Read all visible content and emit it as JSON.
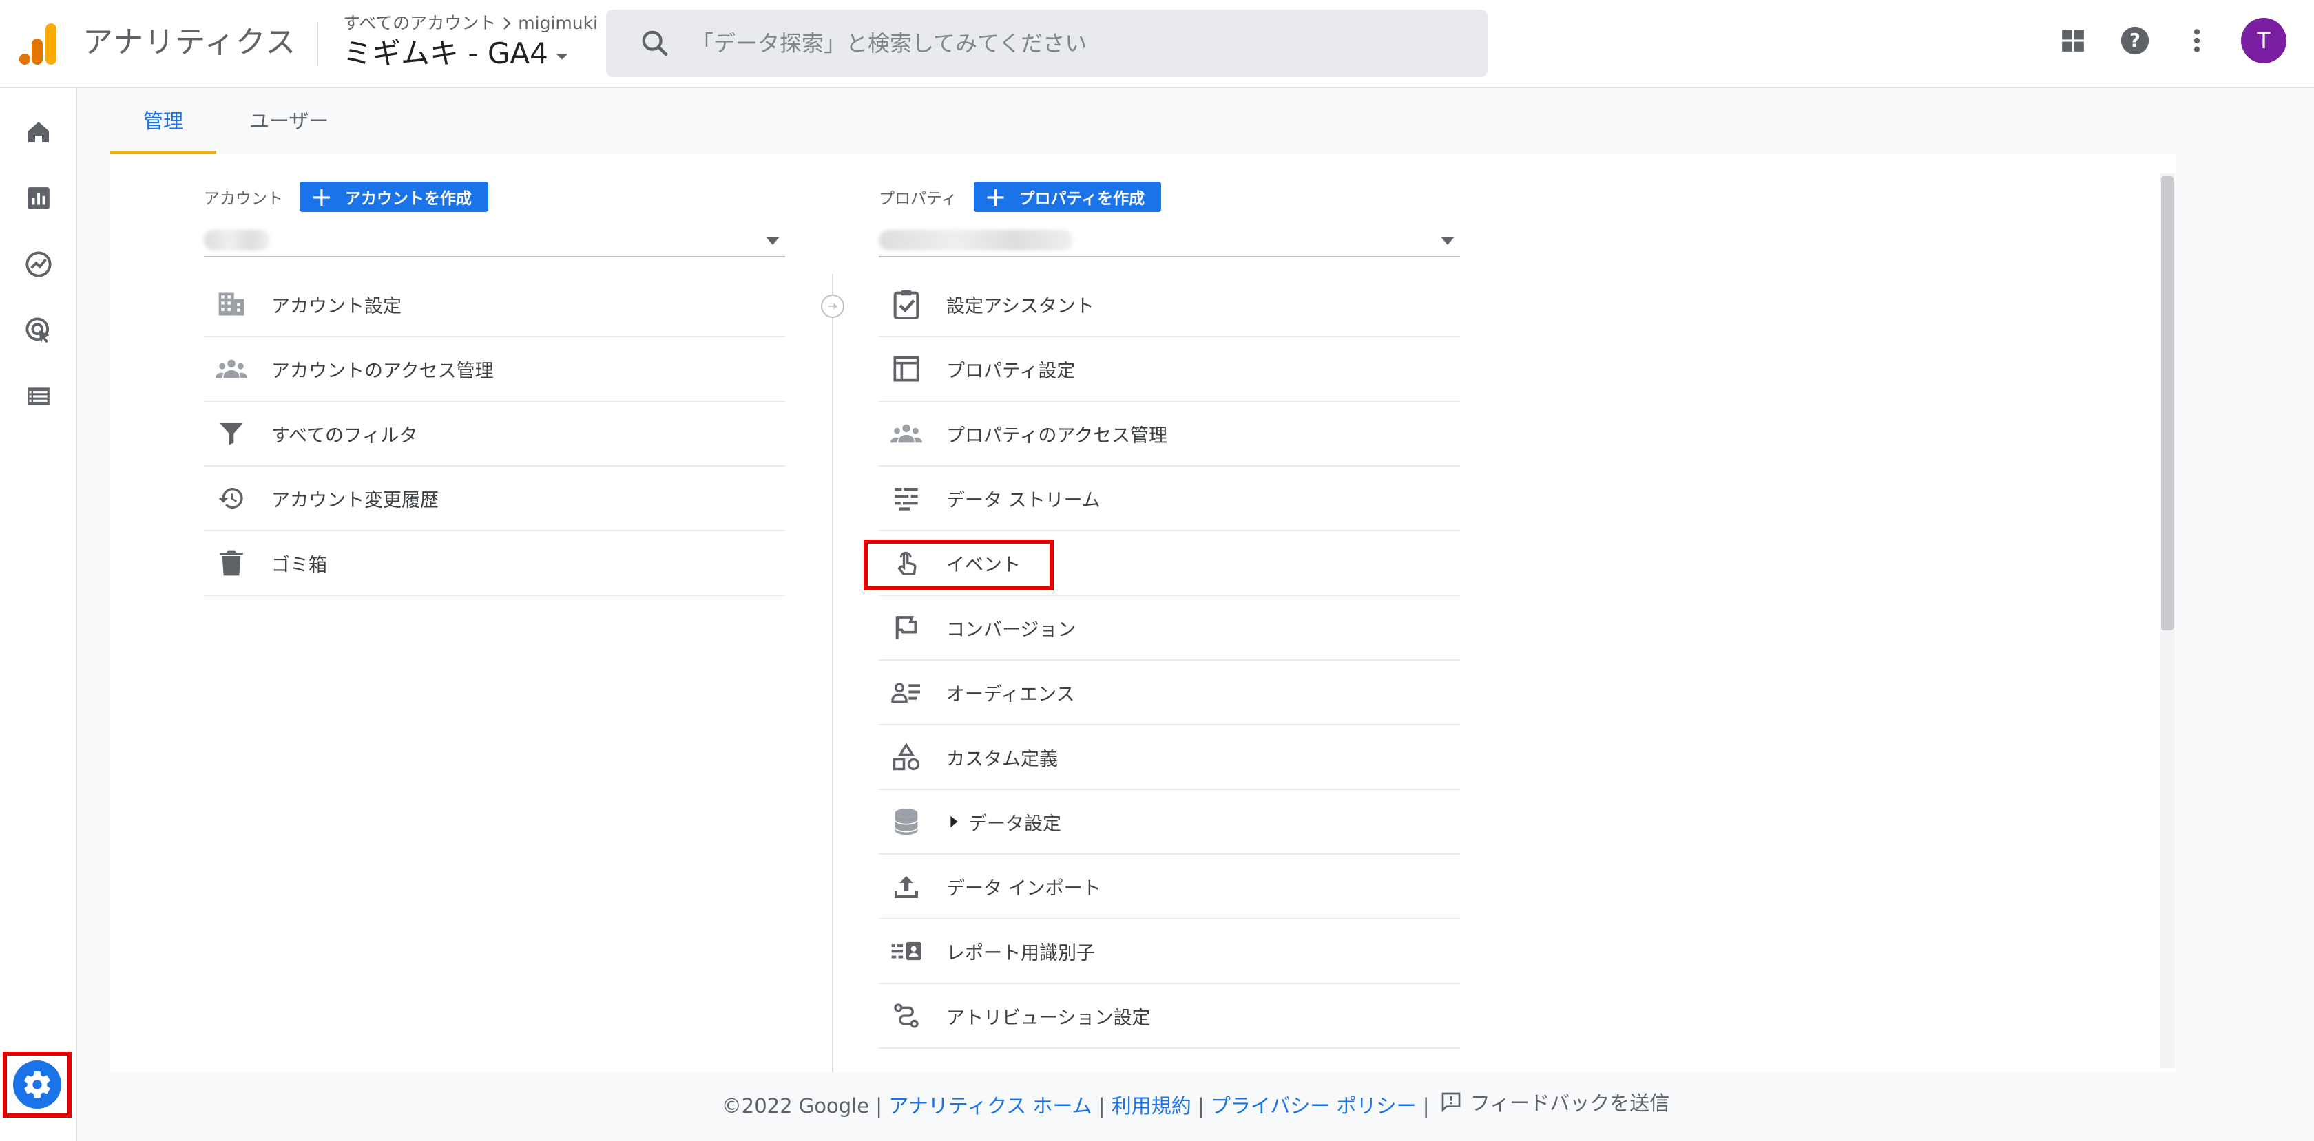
{
  "header": {
    "product_name": "アナリティクス",
    "breadcrumb_all": "すべてのアカウント",
    "breadcrumb_account": "migimuki",
    "property_title": "ミギムキ - GA4",
    "search_placeholder": "「データ探索」と検索してみてください",
    "avatar_initial": "T"
  },
  "tabs": [
    {
      "label": "管理"
    },
    {
      "label": "ユーザー"
    }
  ],
  "account_column": {
    "label": "アカウント",
    "create_button": "アカウントを作成",
    "items": [
      {
        "label": "アカウント設定",
        "icon": "building-icon"
      },
      {
        "label": "アカウントのアクセス管理",
        "icon": "people-icon"
      },
      {
        "label": "すべてのフィルタ",
        "icon": "filter-icon"
      },
      {
        "label": "アカウント変更履歴",
        "icon": "history-icon"
      },
      {
        "label": "ゴミ箱",
        "icon": "trash-icon"
      }
    ]
  },
  "property_column": {
    "label": "プロパティ",
    "create_button": "プロパティを作成",
    "items": [
      {
        "label": "設定アシスタント",
        "icon": "checklist-icon"
      },
      {
        "label": "プロパティ設定",
        "icon": "layout-icon"
      },
      {
        "label": "プロパティのアクセス管理",
        "icon": "people-icon"
      },
      {
        "label": "データ ストリーム",
        "icon": "streams-icon"
      },
      {
        "label": "イベント",
        "icon": "touch-icon"
      },
      {
        "label": "コンバージョン",
        "icon": "flag-icon"
      },
      {
        "label": "オーディエンス",
        "icon": "audience-icon"
      },
      {
        "label": "カスタム定義",
        "icon": "shapes-icon"
      },
      {
        "label": "データ設定",
        "icon": "database-icon"
      },
      {
        "label": "データ インポート",
        "icon": "upload-icon"
      },
      {
        "label": "レポート用識別子",
        "icon": "id-card-icon"
      },
      {
        "label": "アトリビューション設定",
        "icon": "attribution-icon"
      }
    ]
  },
  "footer": {
    "copyright": "©2022 Google",
    "sep": "|",
    "link_home": "アナリティクス ホーム",
    "link_terms": "利用規約",
    "link_privacy": "プライバシー ポリシー",
    "feedback": "フィードバックを送信"
  },
  "colors": {
    "accent": "#1a73e8",
    "tab_underline": "#f9ab00",
    "highlight": "#e60000",
    "avatar": "#7b1fa2"
  }
}
